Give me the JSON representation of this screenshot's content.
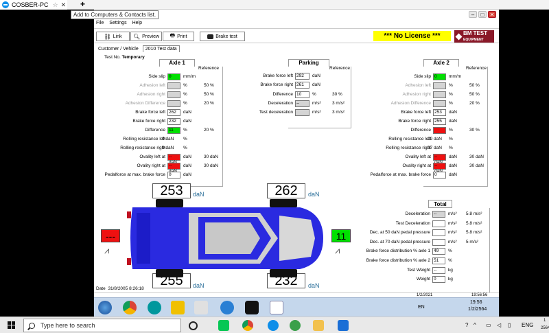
{
  "remote_tab": {
    "title": "COSBER-PC",
    "tooltip": "Add to Computers & Contacts list."
  },
  "menu": [
    "File",
    "Settings",
    "Help"
  ],
  "toolbar": {
    "link": "Link",
    "preview": "Preview",
    "print": "Print",
    "brake_test": "Brake test",
    "no_license": "***  No License  ***",
    "logo_text": "BM TEST",
    "logo_sub": "EQUIPMENT"
  },
  "tabs": [
    "Customer / Vehicle",
    "2010 Test data"
  ],
  "test_no": {
    "label": "Test No.",
    "value": "Temporary"
  },
  "axle1": {
    "title": "Axle 1",
    "reference": "Reference",
    "rows": [
      {
        "label": "Side slip",
        "value": "0",
        "unit": "mm/m",
        "ref": ""
      },
      {
        "label": "Adhesion left",
        "value": "",
        "unit": "%",
        "ref": "50 %"
      },
      {
        "label": "Adhesion right",
        "value": "",
        "unit": "%",
        "ref": "50 %"
      },
      {
        "label": "Adhesion Difference",
        "value": "",
        "unit": "%",
        "ref": "20 %"
      },
      {
        "label": "Brake force left",
        "value": "262",
        "unit": "daN",
        "ref": ""
      },
      {
        "label": "Brake force right",
        "value": "232",
        "unit": "daN",
        "ref": ""
      },
      {
        "label": "Difference",
        "value": "11",
        "unit": "%",
        "ref": "20 %"
      },
      {
        "label": "Rolling resistance left",
        "value": "0 daN",
        "unit": "%",
        "ref": ""
      },
      {
        "label": "Rolling resistance right",
        "value": "0 daN",
        "unit": "%",
        "ref": ""
      },
      {
        "label": "Ovality left at",
        "value": "--daN",
        "unit": "daN",
        "ref": "30 daN"
      },
      {
        "label": "Ovality right at",
        "value": "--daN",
        "unit": "daN",
        "ref": "30 daN"
      },
      {
        "label": "Pedalforce at max. brake force",
        "value": "0",
        "unit": "daN",
        "ref": ""
      }
    ]
  },
  "parking": {
    "title": "Parking",
    "reference": "Reference",
    "rows": [
      {
        "label": "Brake force left",
        "value": "292",
        "unit": "daN",
        "ref": ""
      },
      {
        "label": "Brake force right",
        "value": "261",
        "unit": "daN",
        "ref": ""
      },
      {
        "label": "Difference",
        "value": "10",
        "unit": "%",
        "ref": "30 %"
      },
      {
        "label": "Deceleration",
        "value": "--",
        "unit": "m/s²",
        "ref": "3 m/s²"
      },
      {
        "label": "Test deceleration",
        "value": "",
        "unit": "m/s²",
        "ref": "3 m/s²"
      }
    ]
  },
  "axle2": {
    "title": "Axle 2",
    "reference": "Reference",
    "rows": [
      {
        "label": "Side slip",
        "value": "0",
        "unit": "mm/m",
        "ref": ""
      },
      {
        "label": "Adhesion left",
        "value": "",
        "unit": "%",
        "ref": "50 %"
      },
      {
        "label": "Adhesion right",
        "value": "",
        "unit": "%",
        "ref": "50 %"
      },
      {
        "label": "Adhesion Difference",
        "value": "",
        "unit": "%",
        "ref": "20 %"
      },
      {
        "label": "Brake force left",
        "value": "253",
        "unit": "daN",
        "ref": ""
      },
      {
        "label": "Brake force right",
        "value": "255",
        "unit": "daN",
        "ref": ""
      },
      {
        "label": "Difference",
        "value": "",
        "unit": "%",
        "ref": "30 %"
      },
      {
        "label": "Rolling resistance left",
        "value": "19 daN",
        "unit": "%",
        "ref": ""
      },
      {
        "label": "Rolling resistance right",
        "value": "37 daN",
        "unit": "%",
        "ref": ""
      },
      {
        "label": "Ovality left at",
        "value": "--daN",
        "unit": "daN",
        "ref": "30 daN"
      },
      {
        "label": "Ovality right at",
        "value": "--daN",
        "unit": "daN",
        "ref": "30 daN"
      },
      {
        "label": "Pedalforce at max. brake force",
        "value": "0",
        "unit": "daN",
        "ref": ""
      }
    ]
  },
  "wheels": {
    "rear_left": "253",
    "front_left": "262",
    "rear_right": "255",
    "front_right": "232",
    "unit": "daN",
    "left_side": "---",
    "right_side": "11"
  },
  "total": {
    "title": "Total",
    "rows": [
      {
        "label": "Deceleration",
        "value": "--",
        "unit": "m/s²",
        "ref": "5.8 m/s²"
      },
      {
        "label": "Test Deceleration",
        "value": "",
        "unit": "m/s²",
        "ref": "5.8 m/s²"
      },
      {
        "label": "Dec. at 50 daN pedal pressure",
        "value": "",
        "unit": "m/s²",
        "ref": "5.8 m/s²"
      },
      {
        "label": "Dec. at 70 daN pedal pressure",
        "value": "",
        "unit": "m/s²",
        "ref": "5 m/s²"
      },
      {
        "label": "Brake force distribution % axle 1",
        "value": "49",
        "unit": "%",
        "ref": ""
      },
      {
        "label": "Brake force distribution % axle 2",
        "value": "51",
        "unit": "%",
        "ref": ""
      },
      {
        "label": "Test Weight",
        "value": "--",
        "unit": "kg",
        "ref": ""
      },
      {
        "label": "Weight",
        "value": "0",
        "unit": "kg",
        "ref": ""
      }
    ]
  },
  "date": {
    "label": "Date",
    "value": "31/8/2005 8:26:18"
  },
  "status_date": "1/2/2021",
  "status_time": "19:56:56",
  "remote_tray": {
    "lang": "EN",
    "time": "19:56",
    "date": "1/2/2564"
  },
  "local_taskbar": {
    "search_placeholder": "Type here to search",
    "lang": "ENG",
    "clock": "1",
    "clock_sub": "2564"
  }
}
